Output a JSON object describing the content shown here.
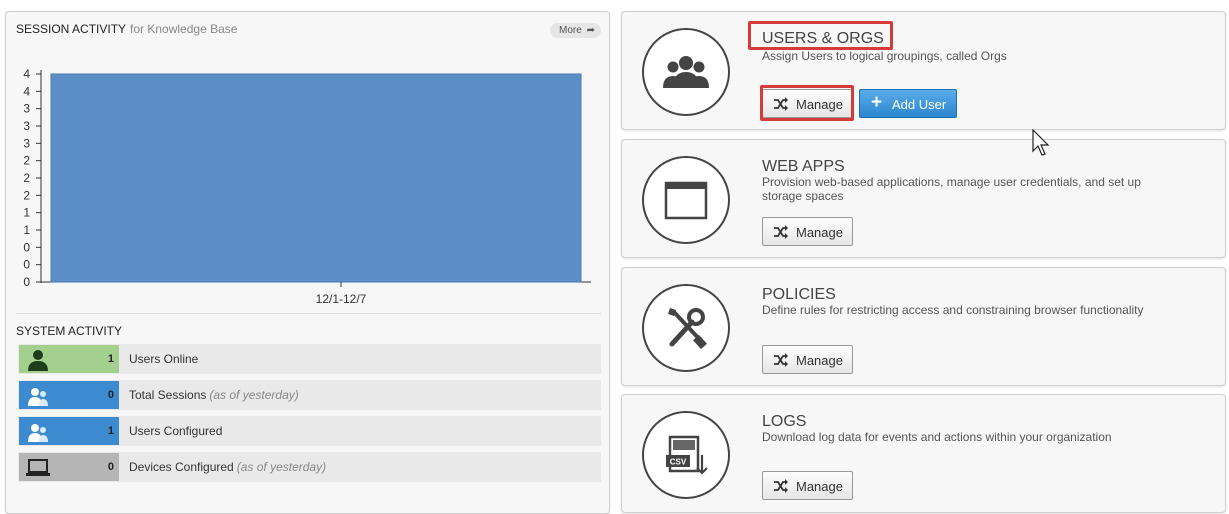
{
  "session": {
    "title": "SESSION ACTIVITY",
    "subtitle": "for Knowledge Base",
    "more_label": "More"
  },
  "chart_data": {
    "type": "area",
    "x": [
      "12/1-12/7"
    ],
    "series": [
      {
        "values": [
          4
        ]
      }
    ],
    "y_tick_labels": [
      "0",
      "0",
      "0",
      "1",
      "1",
      "2",
      "2",
      "2",
      "3",
      "3",
      "3",
      "4",
      "4"
    ],
    "ylim": [
      0,
      4
    ],
    "grid": false,
    "colors": {
      "fill": "#5b8dc6",
      "stroke": "#4a7ab5"
    }
  },
  "system": {
    "title": "SYSTEM ACTIVITY",
    "rows": [
      {
        "count": "1",
        "label": "Users Online",
        "note": "",
        "color": "#a3d08f",
        "icon": "user-silhouette-icon"
      },
      {
        "count": "0",
        "label": "Total Sessions",
        "note": "(as of yesterday)",
        "color": "#3c8ad0",
        "icon": "users-icon"
      },
      {
        "count": "1",
        "label": "Users Configured",
        "note": "",
        "color": "#3c8ad0",
        "icon": "users-icon"
      },
      {
        "count": "0",
        "label": "Devices Configured",
        "note": "(as of yesterday)",
        "color": "#b5b5b5",
        "icon": "laptop-icon"
      }
    ]
  },
  "cards": [
    {
      "title": "USERS & ORGS",
      "desc": "Assign Users to logical groupings, called Orgs",
      "manage_label": "Manage",
      "add_label": "Add User",
      "icon": "users-group-icon"
    },
    {
      "title": "WEB APPS",
      "desc": "Provision web-based applications, manage user credentials, and set up storage spaces",
      "manage_label": "Manage",
      "icon": "browser-window-icon"
    },
    {
      "title": "POLICIES",
      "desc": "Define rules for restricting access and constraining browser functionality",
      "manage_label": "Manage",
      "icon": "tools-icon"
    },
    {
      "title": "LOGS",
      "desc": "Download log data for events and actions within your organization",
      "manage_label": "Manage",
      "icon": "csv-download-icon"
    }
  ],
  "colors": {
    "highlight": "#d63b3b",
    "accent_blue": "#2b86cf"
  }
}
